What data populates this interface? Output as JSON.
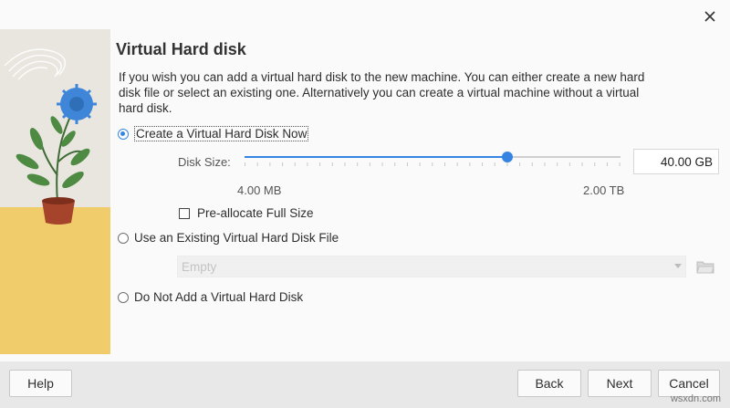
{
  "dialog": {
    "title": "Virtual Hard disk",
    "intro": "If you wish you can add a virtual hard disk to the new machine. You can either create a new hard disk file or select an existing one. Alternatively you can create a virtual machine without a virtual hard disk."
  },
  "options": {
    "create_now": "Create a Virtual Hard Disk Now",
    "use_existing": "Use an Existing Virtual Hard Disk File",
    "do_not_add": "Do Not Add a Virtual Hard Disk",
    "selected": "create_now"
  },
  "disk": {
    "size_label": "Disk Size:",
    "size_value": "40.00 GB",
    "min_label": "4.00 MB",
    "max_label": "2.00 TB",
    "slider_fraction": 0.7,
    "preallocate_label": "Pre-allocate Full Size",
    "preallocate_checked": false
  },
  "existing": {
    "combo_value": "Empty"
  },
  "buttons": {
    "help": "Help",
    "back": "Back",
    "next": "Next",
    "cancel": "Cancel"
  },
  "watermark": "wsxdn.com",
  "colors": {
    "accent": "#3584e4",
    "art_sky": "#e9e6e0",
    "art_ground": "#f1cc6b",
    "footer": "#e8e8e8"
  },
  "icons": [
    "close-icon",
    "folder-icon",
    "combo-arrow-icon"
  ]
}
